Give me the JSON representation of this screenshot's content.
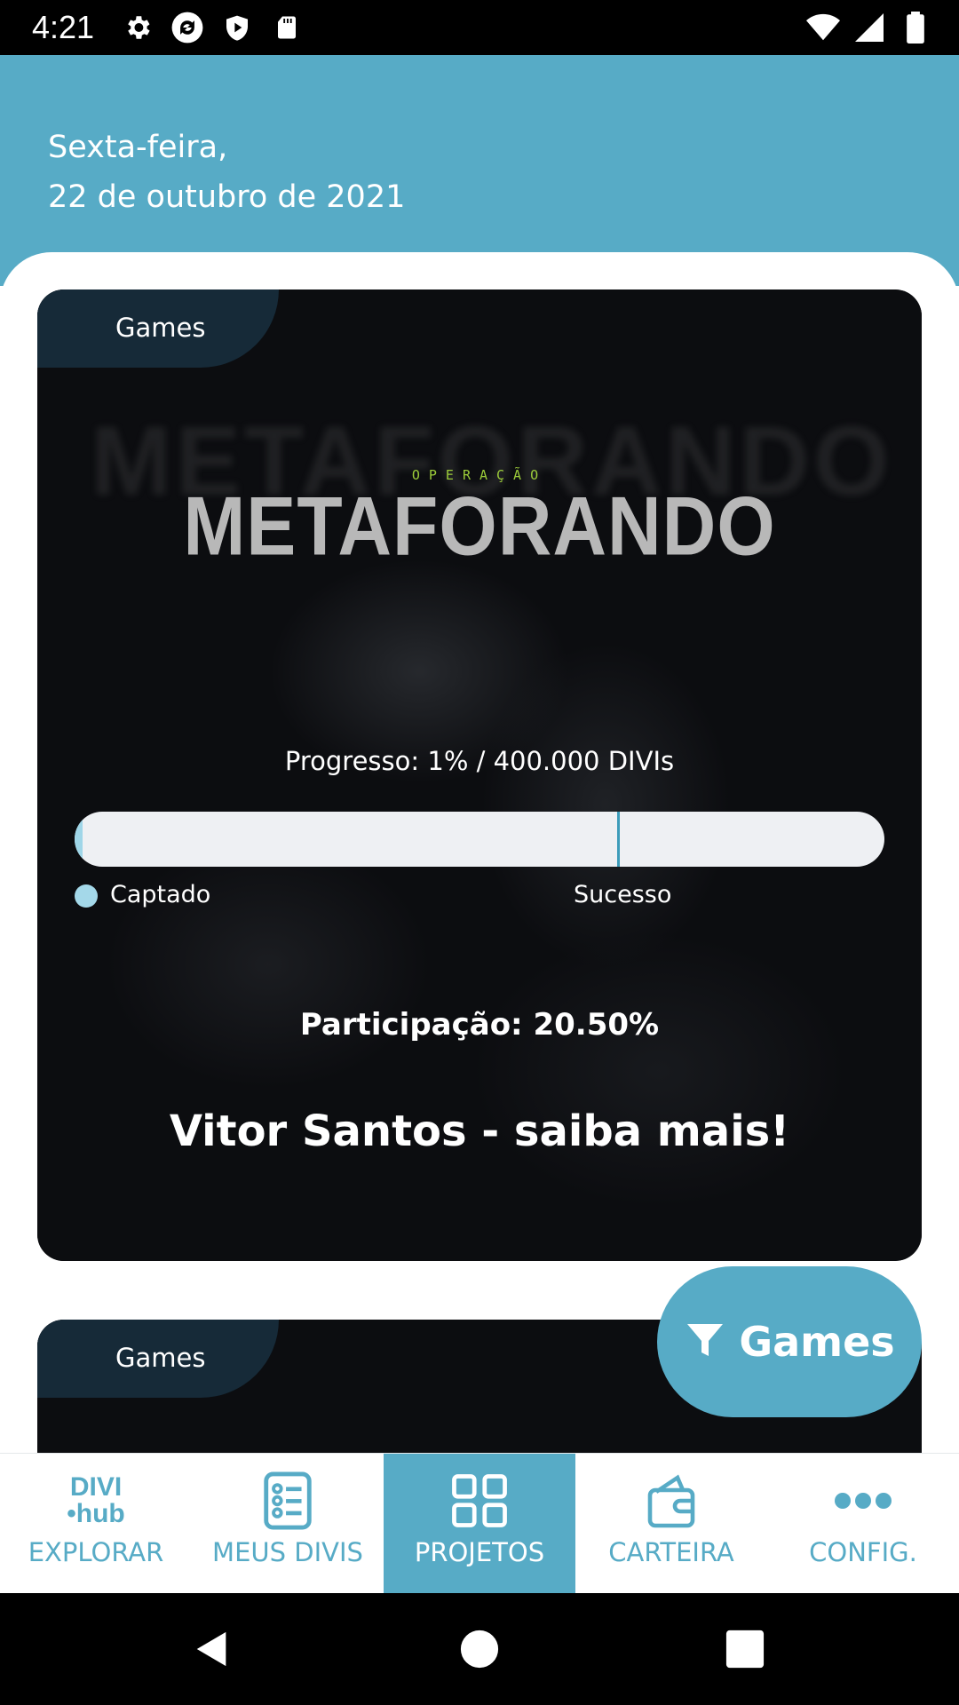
{
  "status_bar": {
    "time": "4:21",
    "icons_left": [
      "gear-icon",
      "sync-icon",
      "shield-icon",
      "sd-card-icon"
    ],
    "icons_right": [
      "wifi-icon",
      "signal-icon",
      "battery-icon"
    ]
  },
  "header": {
    "weekday": "Sexta-feira,",
    "date": "22 de outubro de 2021",
    "background_color": "#57abc6"
  },
  "cards": [
    {
      "category": "Games",
      "logo_small": "OPERAÇÃO",
      "logo_title": "METAFORANDO",
      "progress_label": "Progresso: 1% / 400.000 DIVIs",
      "progress_fraction": 0.01,
      "success_marker_fraction": 0.67,
      "legend_captado": "Captado",
      "legend_sucesso": "Sucesso",
      "participation": "Participação: 20.50%",
      "cta": "Vitor Santos - saiba mais!"
    },
    {
      "category": "Games"
    }
  ],
  "filter_fab": {
    "label": "Games",
    "icon": "filter-icon"
  },
  "bottom_nav": {
    "items": [
      {
        "label": "EXPLORAR",
        "icon": "divi-hub-logo",
        "logo_top": "DIVI",
        "logo_bottom": "•hub",
        "active": false
      },
      {
        "label": "MEUS DIVIS",
        "icon": "list-icon",
        "active": false
      },
      {
        "label": "PROJETOS",
        "icon": "grid-icon",
        "active": true
      },
      {
        "label": "CARTEIRA",
        "icon": "wallet-icon",
        "active": false
      },
      {
        "label": "CONFIG.",
        "icon": "more-icon",
        "active": false
      }
    ],
    "accent_color": "#57abc6"
  },
  "system_nav": [
    "back-icon",
    "home-icon",
    "recents-icon"
  ]
}
